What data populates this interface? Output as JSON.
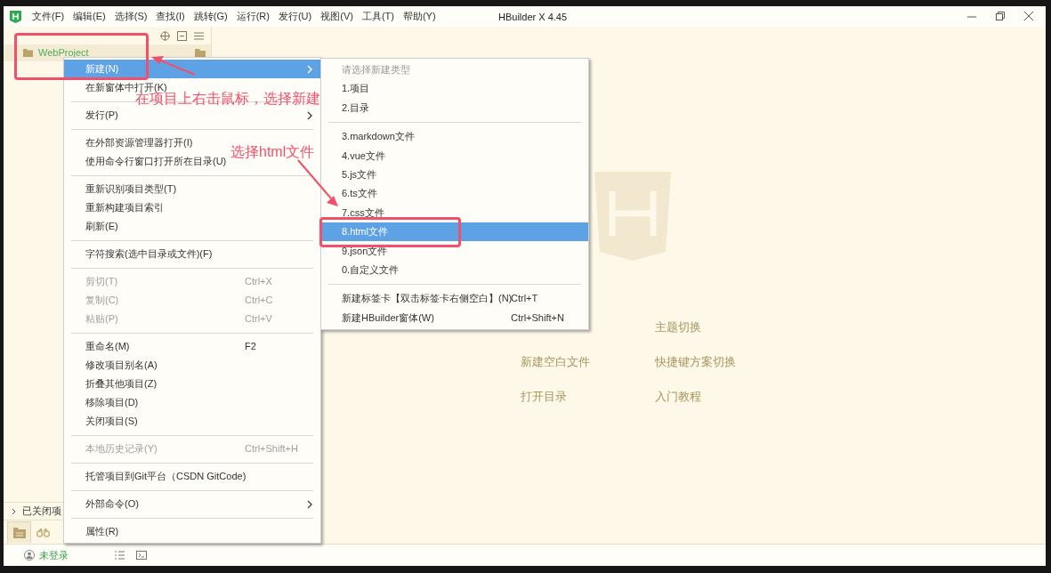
{
  "window": {
    "title": "HBuilder X 4.45"
  },
  "menu_bar": [
    "文件(F)",
    "编辑(E)",
    "选择(S)",
    "查找(I)",
    "跳转(G)",
    "运行(R)",
    "发行(U)",
    "视图(V)",
    "工具(T)",
    "帮助(Y)"
  ],
  "sidebar": {
    "project": "WebProject",
    "closed_projects": "已关闭项",
    "tabs": [
      {
        "kind": "folder",
        "selected": true
      },
      {
        "kind": "binoculars",
        "selected": false
      }
    ]
  },
  "context_menu": {
    "items": [
      {
        "kind": "item",
        "label": "新建(N)",
        "selected": true,
        "disabled": false,
        "has_submenu": true
      },
      {
        "kind": "item",
        "label": "在新窗体中打开(K)",
        "selected": false,
        "disabled": false,
        "has_submenu": false
      },
      {
        "kind": "separator"
      },
      {
        "kind": "item",
        "label": "发行(P)",
        "selected": false,
        "disabled": false,
        "has_submenu": true
      },
      {
        "kind": "separator"
      },
      {
        "kind": "item",
        "label": "在外部资源管理器打开(I)",
        "selected": false,
        "disabled": false,
        "has_submenu": false
      },
      {
        "kind": "item",
        "label": "使用命令行窗口打开所在目录(U)",
        "selected": false,
        "disabled": false,
        "has_submenu": false
      },
      {
        "kind": "separator"
      },
      {
        "kind": "item",
        "label": "重新识别项目类型(T)",
        "selected": false,
        "disabled": false,
        "has_submenu": false
      },
      {
        "kind": "item",
        "label": "重新构建项目索引",
        "selected": false,
        "disabled": false,
        "has_submenu": false
      },
      {
        "kind": "item",
        "label": "刷新(E)",
        "selected": false,
        "disabled": false,
        "has_submenu": false
      },
      {
        "kind": "separator"
      },
      {
        "kind": "item",
        "label": "字符搜索(选中目录或文件)(F)",
        "selected": false,
        "disabled": false,
        "has_submenu": false
      },
      {
        "kind": "separator"
      },
      {
        "kind": "item",
        "label": "剪切(T)",
        "shortcut": "Ctrl+X",
        "selected": false,
        "disabled": true,
        "has_submenu": false
      },
      {
        "kind": "item",
        "label": "复制(C)",
        "shortcut": "Ctrl+C",
        "selected": false,
        "disabled": true,
        "has_submenu": false
      },
      {
        "kind": "item",
        "label": "粘贴(P)",
        "shortcut": "Ctrl+V",
        "selected": false,
        "disabled": true,
        "has_submenu": false
      },
      {
        "kind": "separator"
      },
      {
        "kind": "item",
        "label": "重命名(M)",
        "shortcut": "F2",
        "selected": false,
        "disabled": false,
        "has_submenu": false
      },
      {
        "kind": "item",
        "label": "修改项目别名(A)",
        "selected": false,
        "disabled": false,
        "has_submenu": false
      },
      {
        "kind": "item",
        "label": "折叠其他项目(Z)",
        "selected": false,
        "disabled": false,
        "has_submenu": false
      },
      {
        "kind": "item",
        "label": "移除项目(D)",
        "selected": false,
        "disabled": false,
        "has_submenu": false
      },
      {
        "kind": "item",
        "label": "关闭项目(S)",
        "selected": false,
        "disabled": false,
        "has_submenu": false
      },
      {
        "kind": "separator"
      },
      {
        "kind": "item",
        "label": "本地历史记录(Y)",
        "shortcut": "Ctrl+Shift+H",
        "selected": false,
        "disabled": true,
        "has_submenu": false
      },
      {
        "kind": "separator"
      },
      {
        "kind": "item",
        "label": "托管项目到Git平台（CSDN GitCode)",
        "selected": false,
        "disabled": false,
        "has_submenu": false
      },
      {
        "kind": "separator"
      },
      {
        "kind": "item",
        "label": "外部命令(O)",
        "selected": false,
        "disabled": false,
        "has_submenu": true
      },
      {
        "kind": "separator"
      },
      {
        "kind": "item",
        "label": "属性(R)",
        "selected": false,
        "disabled": false,
        "has_submenu": false
      }
    ]
  },
  "submenu": {
    "header": "请选择新建类型",
    "items": [
      {
        "kind": "item",
        "label": "1.项目",
        "selected": false
      },
      {
        "kind": "item",
        "label": "2.目录",
        "selected": false
      },
      {
        "kind": "separator"
      },
      {
        "kind": "item",
        "label": "3.markdown文件",
        "selected": false
      },
      {
        "kind": "item",
        "label": "4.vue文件",
        "selected": false
      },
      {
        "kind": "item",
        "label": "5.js文件",
        "selected": false
      },
      {
        "kind": "item",
        "label": "6.ts文件",
        "selected": false
      },
      {
        "kind": "item",
        "label": "7.css文件",
        "selected": false
      },
      {
        "kind": "item",
        "label": "8.html文件",
        "selected": true
      },
      {
        "kind": "item",
        "label": "9.json文件",
        "selected": false
      },
      {
        "kind": "item",
        "label": "0.自定义文件",
        "selected": false
      },
      {
        "kind": "separator"
      },
      {
        "kind": "item",
        "label": "新建标签卡【双击标签卡右侧空白】(N)",
        "shortcut": "Ctrl+T",
        "selected": false
      },
      {
        "kind": "item",
        "label": "新建HBuilder窗体(W)",
        "shortcut": "Ctrl+Shift+N",
        "selected": false
      }
    ]
  },
  "welcome_links": [
    "主题切换",
    "新建空白文件",
    "快捷键方案切换",
    "打开目录",
    "入门教程"
  ],
  "status_bar": {
    "user": "未登录"
  },
  "annotations": [
    "在项目上右击鼠标，选择新建",
    "选择html文件"
  ]
}
